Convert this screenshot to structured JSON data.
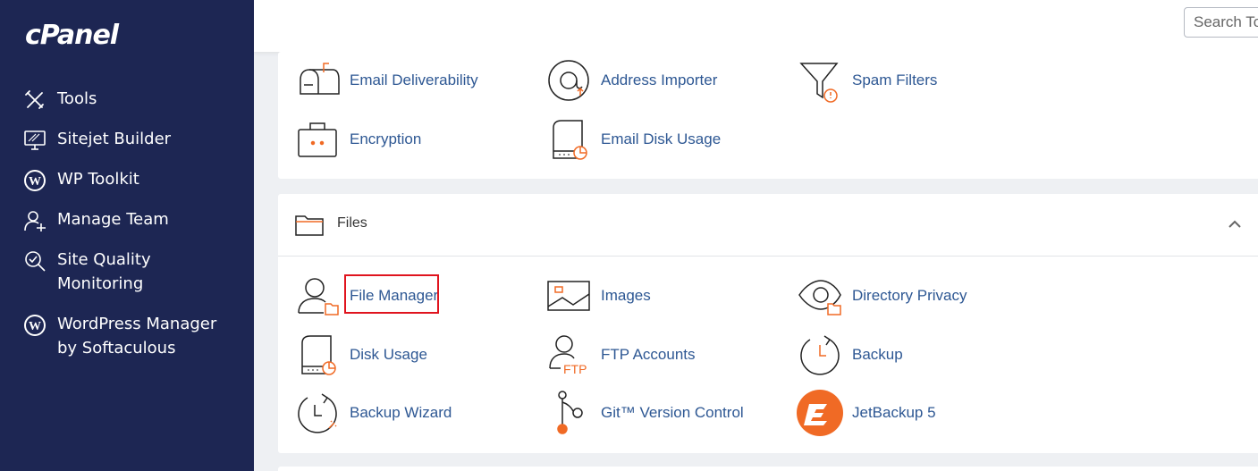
{
  "app": {
    "logo": "cPanel"
  },
  "sidebar": {
    "items": [
      {
        "label": "Tools",
        "icon": "tools-icon"
      },
      {
        "label": "Sitejet Builder",
        "icon": "sitejet-icon"
      },
      {
        "label": "WP Toolkit",
        "icon": "wordpress-icon"
      },
      {
        "label": "Manage Team",
        "icon": "manage-team-icon"
      },
      {
        "label": "Site Quality\nMonitoring",
        "icon": "site-quality-icon"
      },
      {
        "label": "WordPress Manager\nby Softaculous",
        "icon": "wordpress-icon"
      }
    ]
  },
  "search": {
    "placeholder": "Search To"
  },
  "email_section": {
    "items": [
      {
        "label": "Email Deliverability",
        "icon": "mailbox-icon"
      },
      {
        "label": "Address Importer",
        "icon": "at-sign-icon"
      },
      {
        "label": "Spam Filters",
        "icon": "funnel-icon"
      },
      {
        "label": "Encryption",
        "icon": "briefcase-icon"
      },
      {
        "label": "Email Disk Usage",
        "icon": "disk-usage-icon"
      }
    ]
  },
  "files_section": {
    "title": "Files",
    "items": [
      {
        "label": "File Manager",
        "icon": "file-manager-icon"
      },
      {
        "label": "Images",
        "icon": "image-icon"
      },
      {
        "label": "Directory Privacy",
        "icon": "eye-folder-icon"
      },
      {
        "label": "Disk Usage",
        "icon": "disk-usage-icon"
      },
      {
        "label": "FTP Accounts",
        "icon": "ftp-user-icon"
      },
      {
        "label": "Backup",
        "icon": "backup-icon"
      },
      {
        "label": "Backup Wizard",
        "icon": "backup-wizard-icon"
      },
      {
        "label": "Git™ Version Control",
        "icon": "git-icon"
      },
      {
        "label": "JetBackup 5",
        "icon": "jetbackup-icon"
      }
    ]
  },
  "colors": {
    "sidebar": "#1d2653",
    "link": "#2d5793",
    "accent": "#f06a25",
    "highlight": "#e0141e"
  }
}
